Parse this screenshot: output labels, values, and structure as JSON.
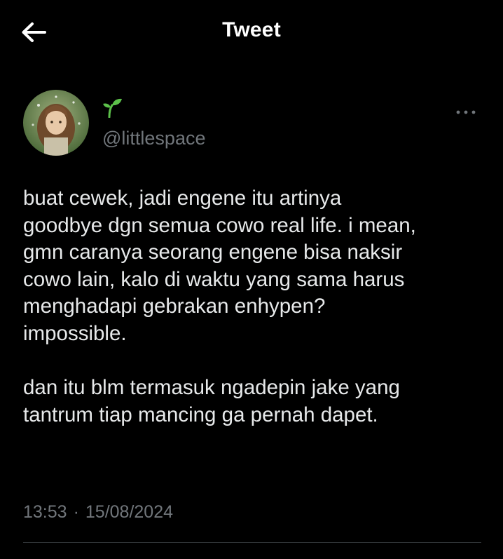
{
  "header": {
    "title": "Tweet",
    "back_icon": "arrow-left-icon"
  },
  "author": {
    "avatar": "avatar-illustration",
    "display_name_icon": "seedling-emoji-icon",
    "handle": "@littlespace",
    "more_icon": "more-horizontal-icon"
  },
  "tweet": {
    "lines_p1": [
      "buat cewek, jadi engene itu artinya",
      "goodbye dgn semua cowo real life. i mean,",
      "gmn caranya seorang engene bisa naksir",
      "cowo lain, kalo di waktu yang sama harus",
      "menghadapi gebrakan enhypen?",
      "impossible."
    ],
    "lines_p2": [
      "dan itu blm termasuk ngadepin jake yang",
      "tantrum tiap mancing ga pernah dapet."
    ]
  },
  "meta": {
    "time": "13:53",
    "separator": "·",
    "date": "15/08/2024"
  },
  "colors": {
    "background": "#000000",
    "text": "#e7e9ea",
    "secondary": "#71767b",
    "divider": "#2f3336",
    "seedling": "#5cc04a"
  }
}
